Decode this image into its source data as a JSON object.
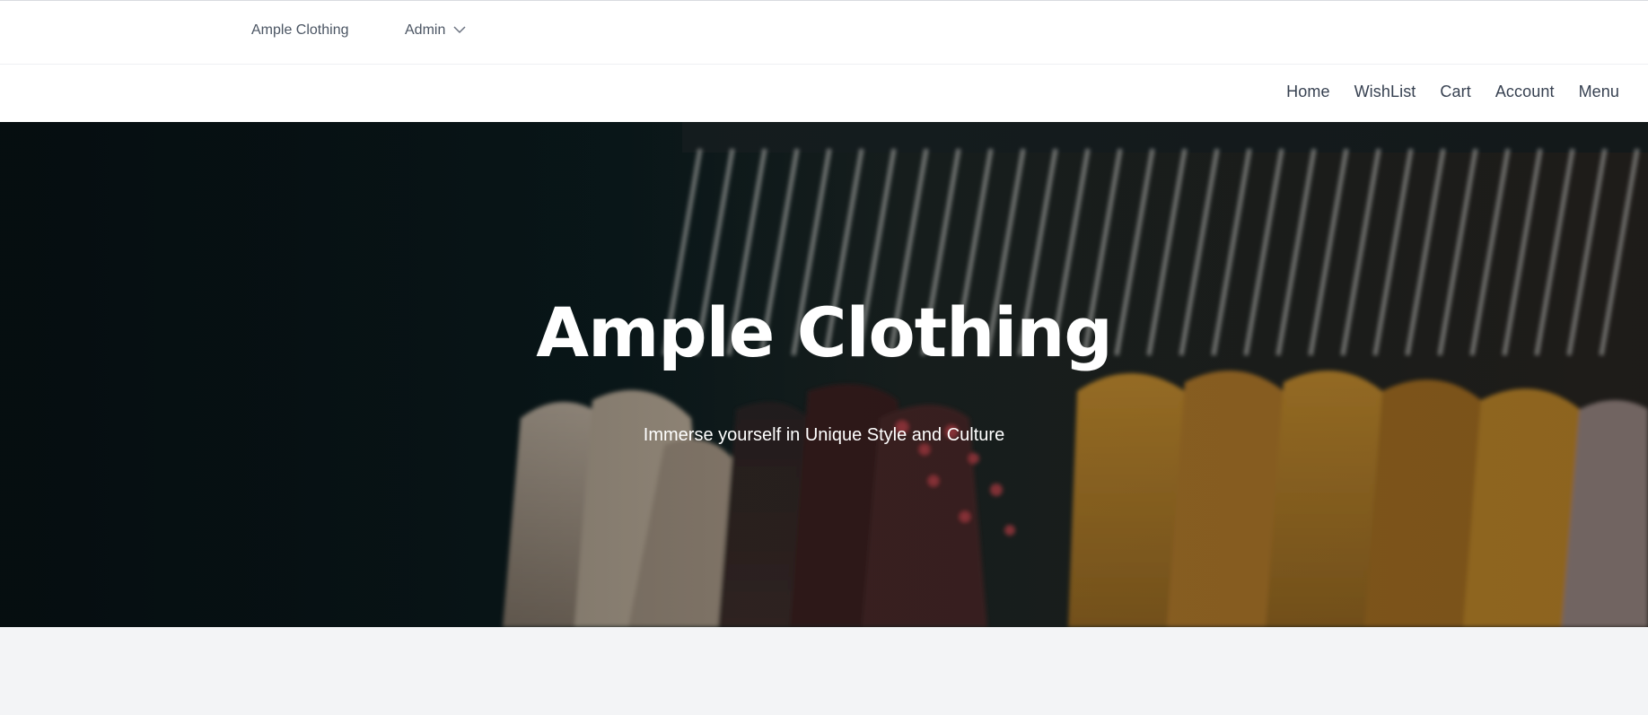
{
  "admin_bar": {
    "brand": "Ample Clothing",
    "admin_label": "Admin",
    "admin_icon": "chevron-down-icon"
  },
  "nav": {
    "links": [
      "Home",
      "WishList",
      "Cart",
      "Account",
      "Menu"
    ]
  },
  "hero": {
    "title": "Ample Clothing",
    "subtitle": "Immerse yourself in Unique Style and Culture",
    "background_image": "clothing rack with hangers and garments"
  },
  "colors": {
    "nav_text": "#374151",
    "admin_text": "#4b5563",
    "hero_text": "#ffffff",
    "page_background": "#f3f4f6"
  }
}
